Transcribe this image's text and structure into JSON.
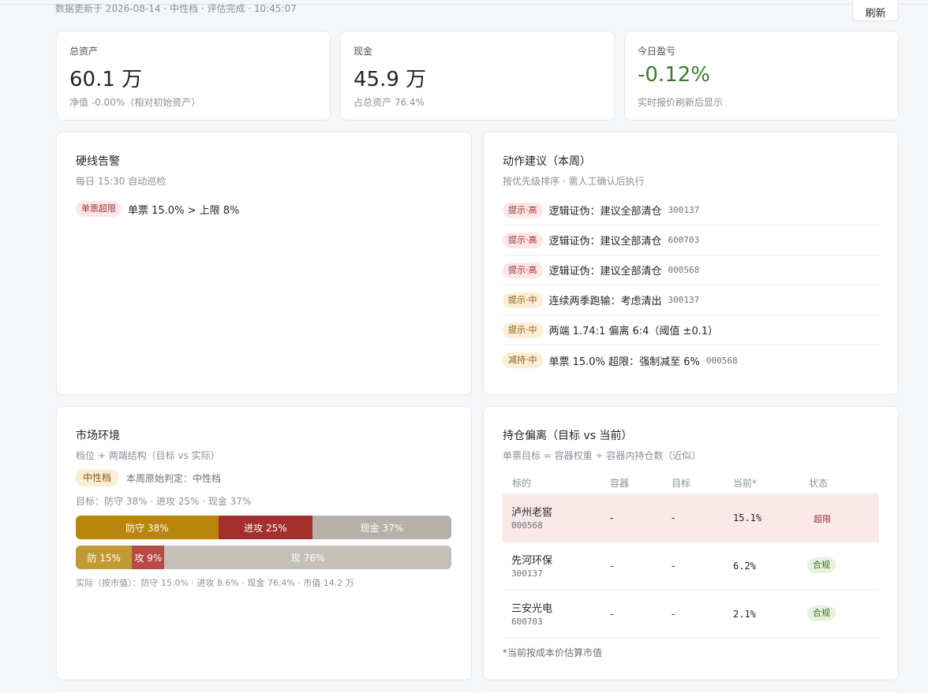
{
  "header": {
    "updated": "数据更新于 2026-08-14 · 中性档 · 评估完成 · 10:45:07",
    "refresh_label": "刷新"
  },
  "stats": [
    {
      "label": "总资产",
      "value": "60.1 万",
      "sub": "净值 -0.00%（相对初始资产）"
    },
    {
      "label": "现金",
      "value": "45.9 万",
      "sub": "占总资产 76.4%"
    },
    {
      "label": "今日盈亏",
      "value": "-0.12%",
      "sub": "实时报价刷新后显示",
      "color": "#3d7a2a"
    }
  ],
  "hard_alerts": {
    "title": "硬线告警",
    "subtitle": "每日 15:30 自动巡检",
    "items": [
      {
        "badge": "单票超限",
        "text": "单票 15.0% > 上限 8%"
      }
    ]
  },
  "actions": {
    "title": "动作建议（本周）",
    "subtitle": "按优先级排序 · 需人工确认后执行",
    "items": [
      {
        "badge": "提示·高",
        "level": "red",
        "text": "逻辑证伪：建议全部清仓",
        "code": "300137"
      },
      {
        "badge": "提示·高",
        "level": "red",
        "text": "逻辑证伪：建议全部清仓",
        "code": "600703"
      },
      {
        "badge": "提示·高",
        "level": "red",
        "text": "逻辑证伪：建议全部清仓",
        "code": "000568"
      },
      {
        "badge": "提示·中",
        "level": "amber",
        "text": "连续两季跑输：考虑清出",
        "code": "300137"
      },
      {
        "badge": "提示·中",
        "level": "amber",
        "text": "两端 1.74:1 偏离 6:4（阈值 ±0.1）",
        "code": ""
      },
      {
        "badge": "减持·中",
        "level": "amber",
        "text": "单票 15.0% 超限：强制减至 6%",
        "code": "000568"
      }
    ]
  },
  "market": {
    "title": "市场环境",
    "subtitle": "档位 + 两端结构（目标 vs 实际）",
    "tier_badge": "中性档",
    "raw_judgment": "本周原始判定：中性档",
    "target_line": "目标：防守 38% · 进攻 25% · 现金 37%",
    "target_bar": [
      {
        "label": "防守 38%",
        "pct": 38,
        "color": "#b8860b"
      },
      {
        "label": "进攻 25%",
        "pct": 25,
        "color": "#a3302f"
      },
      {
        "label": "现金 37%",
        "pct": 37,
        "color": "#b5b1a8"
      }
    ],
    "actual_bar": [
      {
        "label": "防 15%",
        "pct": 15.0,
        "color": "#c29a34"
      },
      {
        "label": "攻 9%",
        "pct": 8.6,
        "color": "#b74a46"
      },
      {
        "label": "现 76%",
        "pct": 76.4,
        "color": "#c4c0b8"
      }
    ],
    "actual_line": "实际（按市值）：防守 15.0% · 进攻 8.6% · 现金 76.4% · 市值 14.2 万"
  },
  "holdings": {
    "title": "持仓偏离（目标 vs 当前）",
    "subtitle": "单票目标 = 容器权重 ÷ 容器内持仓数（近似）",
    "columns": [
      "标的",
      "容器",
      "目标",
      "当前*",
      "状态"
    ],
    "rows": [
      {
        "name": "泸州老窖",
        "code": "000568",
        "container": "-",
        "target": "-",
        "current": "15.1%",
        "status": "超限",
        "status_type": "red"
      },
      {
        "name": "先河环保",
        "code": "300137",
        "container": "-",
        "target": "-",
        "current": "6.2%",
        "status": "合规",
        "status_type": "green"
      },
      {
        "name": "三安光电",
        "code": "600703",
        "container": "-",
        "target": "-",
        "current": "2.1%",
        "status": "合规",
        "status_type": "green"
      }
    ],
    "note": "*当前按成本价估算市值"
  }
}
